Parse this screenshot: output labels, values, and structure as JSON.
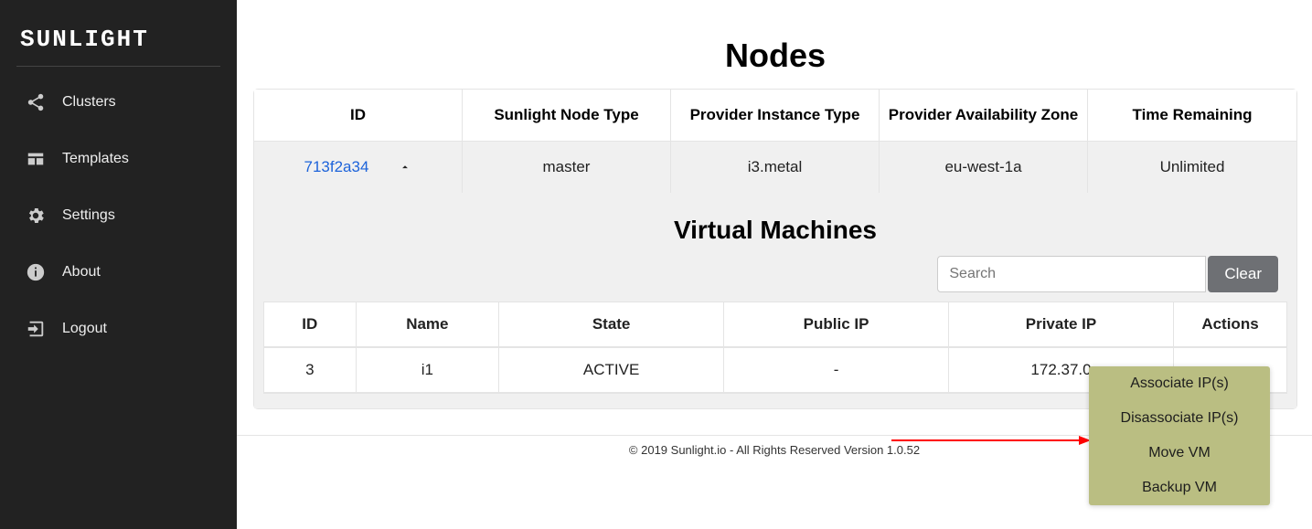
{
  "brand": "SUNLIGHT",
  "sidebar": {
    "items": [
      {
        "label": "Clusters",
        "icon": "share"
      },
      {
        "label": "Templates",
        "icon": "templates"
      },
      {
        "label": "Settings",
        "icon": "gear"
      },
      {
        "label": "About",
        "icon": "info"
      },
      {
        "label": "Logout",
        "icon": "logout"
      }
    ]
  },
  "nodes": {
    "title": "Nodes",
    "columns": [
      "ID",
      "Sunlight Node Type",
      "Provider Instance Type",
      "Provider Availability Zone",
      "Time Remaining"
    ],
    "row": {
      "id": "713f2a34",
      "node_type": "master",
      "instance_type": "i3.metal",
      "az": "eu-west-1a",
      "time_remaining": "Unlimited"
    }
  },
  "vms": {
    "title": "Virtual Machines",
    "search_placeholder": "Search",
    "clear_label": "Clear",
    "columns": [
      "ID",
      "Name",
      "State",
      "Public IP",
      "Private IP",
      "Actions"
    ],
    "row": {
      "id": "3",
      "name": "i1",
      "state": "ACTIVE",
      "public_ip": "-",
      "private_ip": "172.37.0",
      "actions": ""
    }
  },
  "actions_menu": {
    "items": [
      "Associate IP(s)",
      "Disassociate IP(s)",
      "Move VM",
      "Backup VM"
    ]
  },
  "footer": "© 2019 Sunlight.io - All Rights Reserved Version 1.0.52"
}
